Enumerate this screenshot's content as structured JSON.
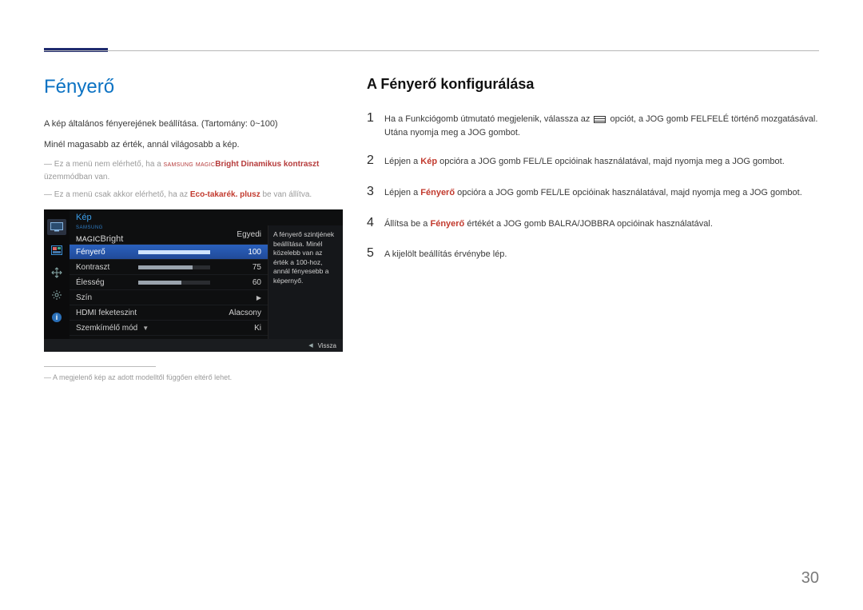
{
  "left": {
    "heading": "Fényerő",
    "p1": "A kép általános fényerejének beállítása. (Tartomány: 0~100)",
    "p2": "Minél magasabb az érték, annál világosabb a kép.",
    "note1_pre": "Ez a menü nem elérhető, ha a ",
    "brand_small": "SAMSUNG",
    "brand_magic": "MAGIC",
    "note1_bold": "Bright Dinamikus kontraszt",
    "note1_post": " üzemmódban van.",
    "note2_pre": "Ez a menü csak akkor elérhető, ha az ",
    "note2_bold": "Eco-takarék. plusz",
    "note2_post": " be van állítva.",
    "footnote": "A megjelenő kép az adott modelltől függően eltérő lehet."
  },
  "osd": {
    "title": "Kép",
    "rows": [
      {
        "label_pre": "",
        "samsung": "SAMSUNG",
        "magic": "MAGIC",
        "label_post": "Bright",
        "value": "Egyedi",
        "type": "text"
      },
      {
        "label": "Fényerő",
        "value": "100",
        "type": "slider",
        "pct": 100,
        "selected": true
      },
      {
        "label": "Kontraszt",
        "value": "75",
        "type": "slider",
        "pct": 75
      },
      {
        "label": "Élesség",
        "value": "60",
        "type": "slider",
        "pct": 60
      },
      {
        "label": "Szín",
        "value": "",
        "type": "arrow"
      },
      {
        "label": "HDMI feketeszint",
        "value": "Alacsony",
        "type": "text"
      },
      {
        "label": "Szemkímélő mód",
        "value": "Ki",
        "type": "text",
        "down": true
      }
    ],
    "desc": "A fényerő szintjének beállítása. Minél közelebb van az érték a 100-hoz, annál fényesebb a képernyő.",
    "back": "Vissza"
  },
  "right": {
    "heading": "A Fényerő konfigurálása",
    "steps": {
      "s1_pre": "Ha a Funkciógomb útmutató megjelenik, válassza az ",
      "s1_post": " opciót, a JOG gomb FELFELÉ történő mozgatásával. Utána nyomja meg a JOG gombot.",
      "s2_pre": "Lépjen a ",
      "s2_bold": "Kép",
      "s2_post": " opcióra a JOG gomb FEL/LE opcióinak használatával, majd nyomja meg a JOG gombot.",
      "s3_pre": "Lépjen a ",
      "s3_bold": "Fényerő",
      "s3_post": " opcióra a JOG gomb FEL/LE opcióinak használatával, majd nyomja meg a JOG gombot.",
      "s4_pre": "Állítsa be a ",
      "s4_bold": "Fényerő",
      "s4_post": " értékét a JOG gomb BALRA/JOBBRA opcióinak használatával.",
      "s5": "A kijelölt beállítás érvénybe lép."
    }
  },
  "page_number": "30"
}
